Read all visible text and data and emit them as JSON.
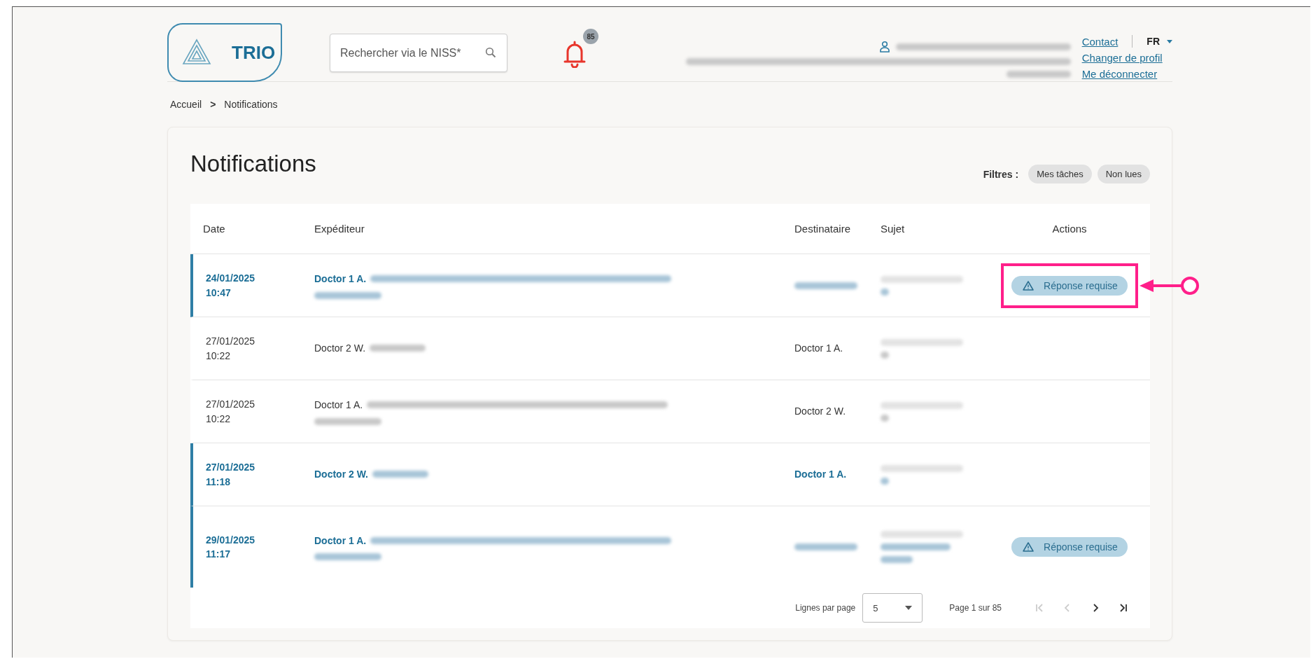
{
  "logo": {
    "text": "TRIO"
  },
  "search": {
    "placeholder": "Rechercher via le NISS*"
  },
  "notifications": {
    "count": "85"
  },
  "header_links": [
    {
      "label": "Contact"
    },
    {
      "label": "Changer de profil"
    },
    {
      "label": "Me déconnecter"
    }
  ],
  "language": {
    "value": "FR"
  },
  "breadcrumb": [
    {
      "label": "Accueil"
    },
    {
      "label": ">",
      "kind": "separator"
    },
    {
      "label": "Notifications"
    }
  ],
  "page_title": "Notifications",
  "filters": {
    "label": "Filtres :",
    "chips": [
      {
        "label": "Mes tâches",
        "selected": false
      },
      {
        "label": "Non lues",
        "selected": false
      }
    ]
  },
  "table": {
    "columns": [
      "Date",
      "Expéditeur",
      "Destinataire",
      "Sujet",
      "Actions"
    ],
    "rows": [
      {
        "date": "24/01/2025",
        "time": "10:47",
        "unread": true,
        "sender": "Doctor 1 A.",
        "sender_detail_wrapped": true,
        "subject_wrapped": false,
        "action": {
          "label": "Réponse requise",
          "highlighted": true
        }
      },
      {
        "date": "27/01/2025",
        "time": "10:22",
        "unread": false,
        "sender": "Doctor 2 W.",
        "sender_detail_wrapped": false,
        "recipient": "Doctor 1 A.",
        "subject_wrapped": false
      },
      {
        "date": "27/01/2025",
        "time": "10:22",
        "unread": false,
        "sender": "Doctor 1 A.",
        "sender_detail_wrapped": true,
        "recipient": "Doctor 2 W.",
        "subject_wrapped": false
      },
      {
        "date": "27/01/2025",
        "time": "11:18",
        "unread": true,
        "sender": "Doctor 2 W.",
        "sender_detail_wrapped": false,
        "recipient": "Doctor 1 A.",
        "subject_wrapped": false
      },
      {
        "date": "29/01/2025",
        "time": "11:17",
        "unread": true,
        "sender": "Doctor 1 A.",
        "sender_detail_wrapped": true,
        "subject_wrapped": true,
        "action": {
          "label": "Réponse requise",
          "highlighted": false
        }
      }
    ]
  },
  "pagination": {
    "rows_label": "Lignes par page",
    "rows_value": "5",
    "page_label": "Page 1 sur 85",
    "buttons": [
      {
        "kind": "first",
        "disabled": true
      },
      {
        "kind": "prev",
        "disabled": true
      },
      {
        "kind": "next",
        "disabled": false
      },
      {
        "kind": "last",
        "disabled": false
      }
    ]
  }
}
